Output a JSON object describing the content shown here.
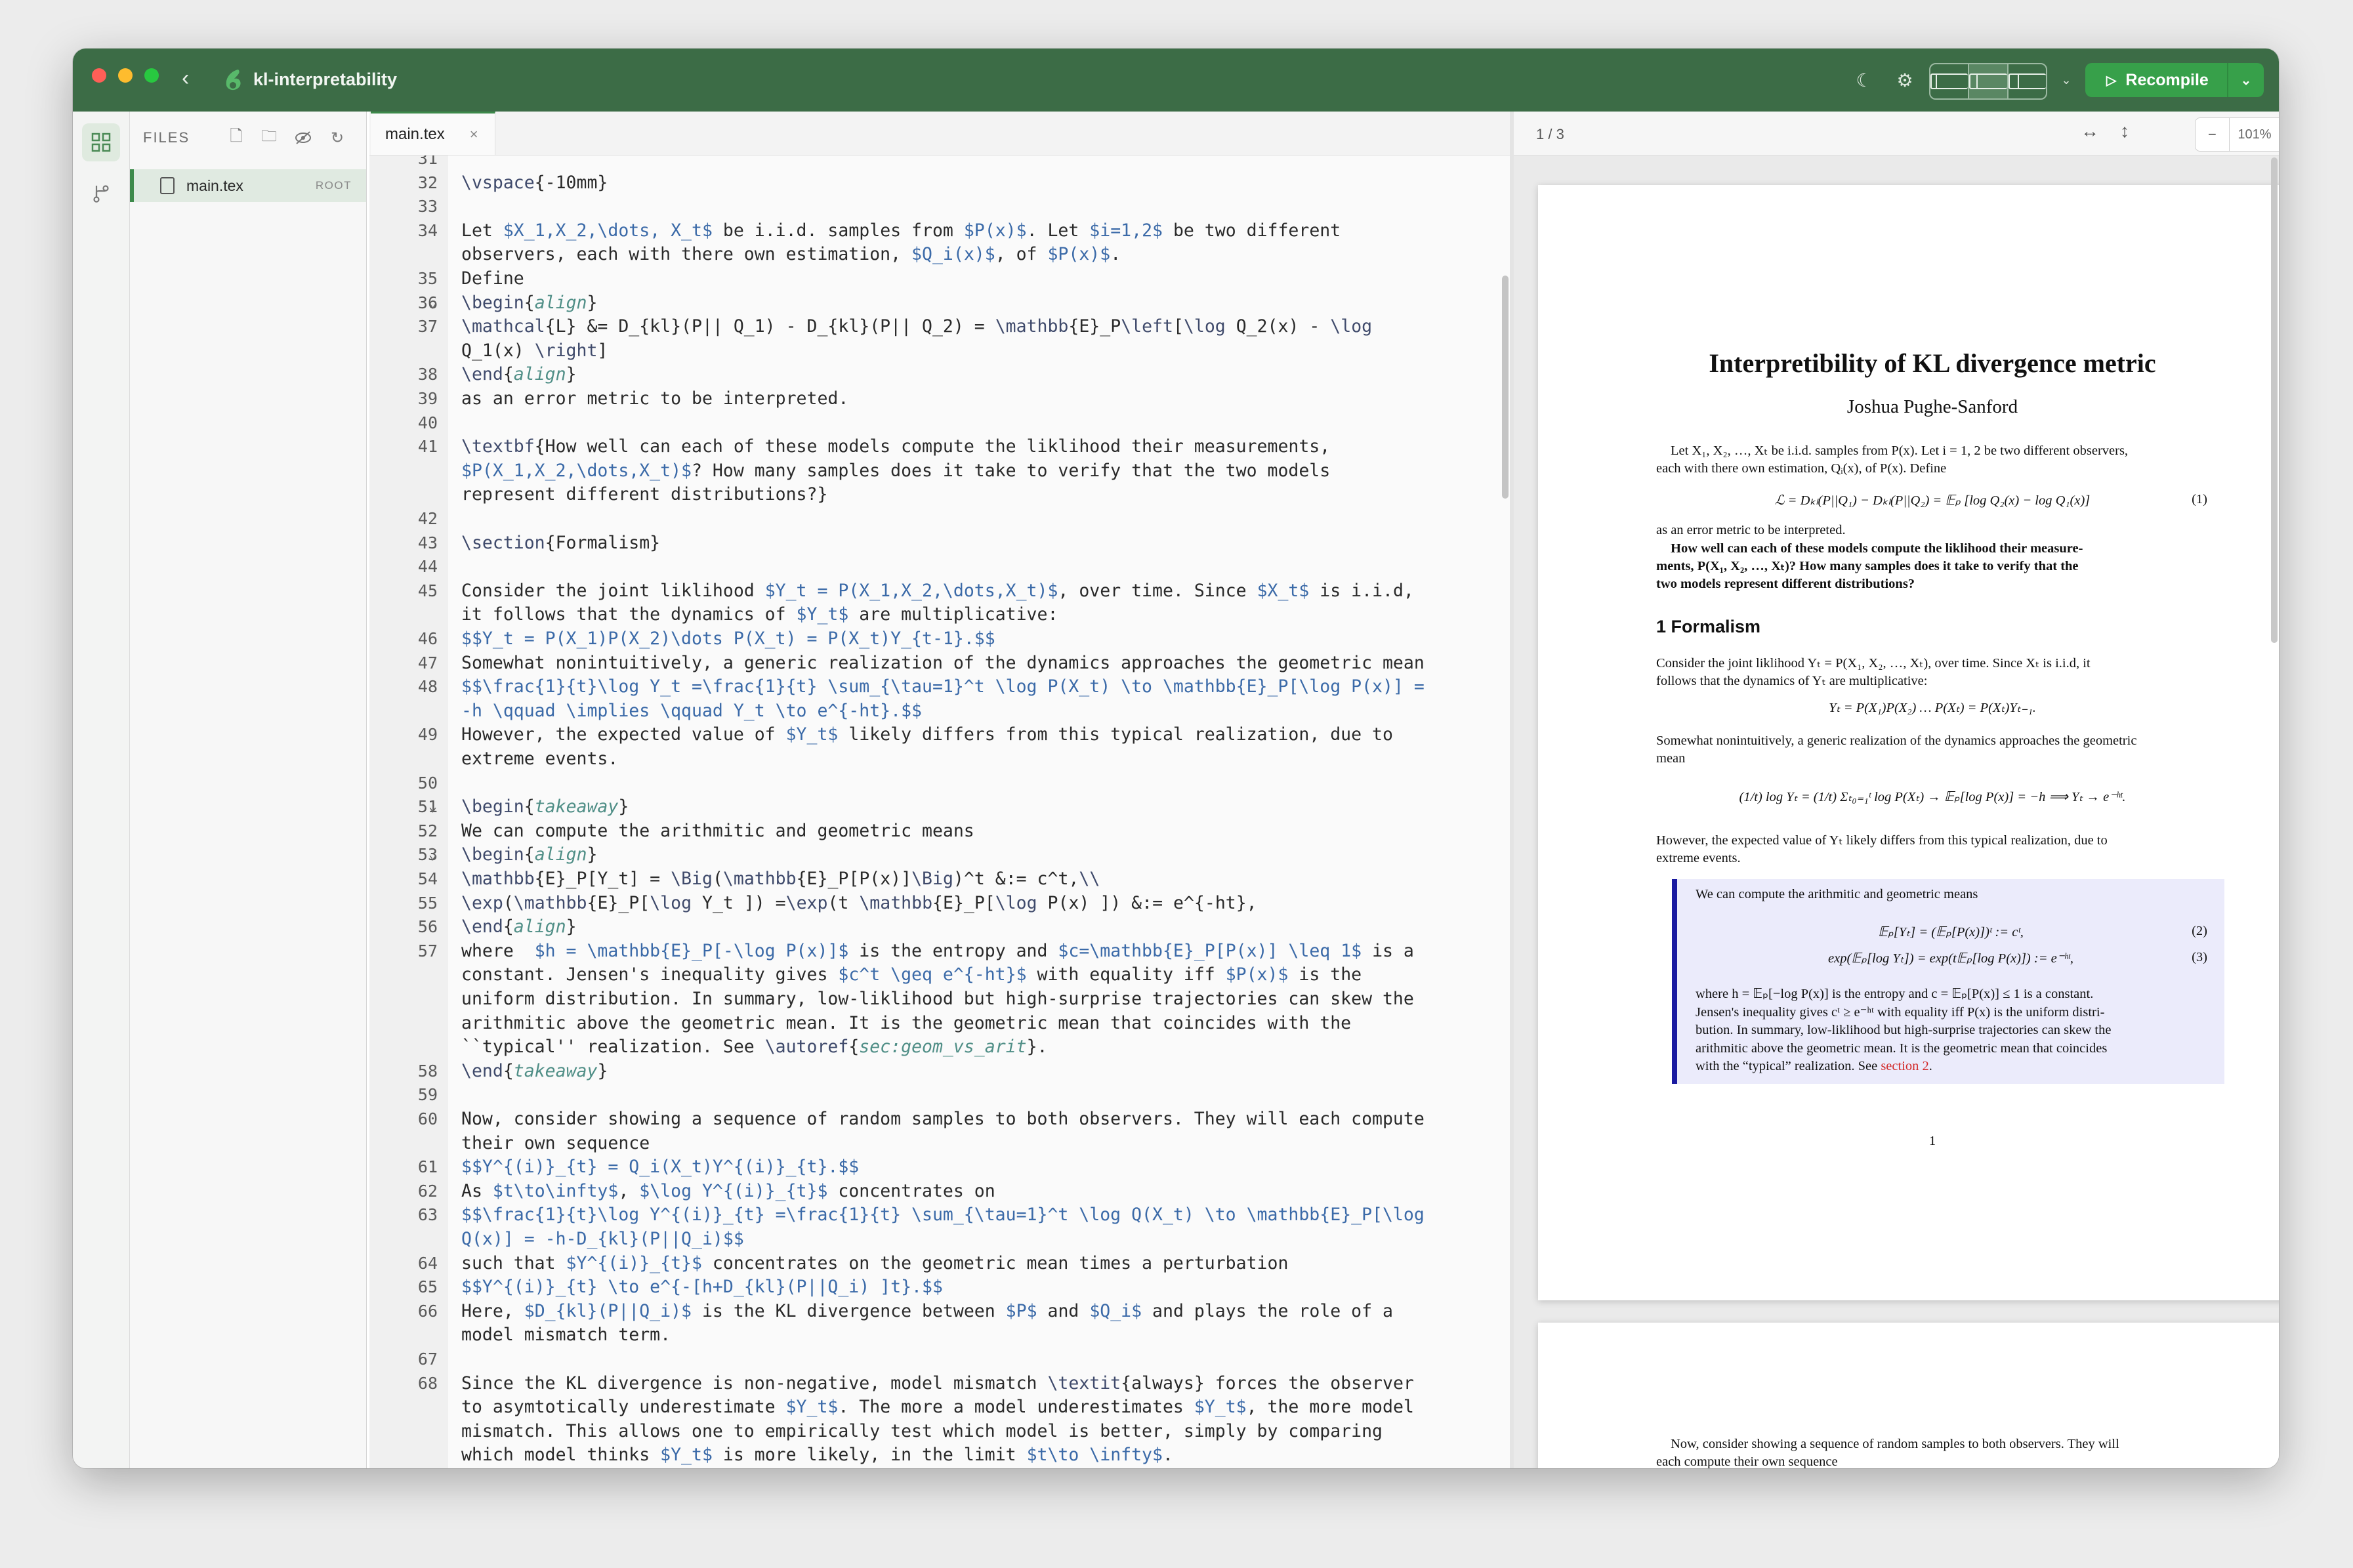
{
  "titlebar": {
    "project_name": "kl-interpretability",
    "recompile_label": "Recompile"
  },
  "file_panel": {
    "header": "FILES",
    "files": [
      {
        "name": "main.tex",
        "badge": "ROOT"
      }
    ]
  },
  "editor": {
    "tab_label": "main.tex",
    "lines": [
      {
        "n": "31",
        "segs": []
      },
      {
        "n": "32",
        "segs": [
          [
            "c",
            "\\vspace"
          ],
          [
            "t",
            "{-10mm}"
          ]
        ]
      },
      {
        "n": "33",
        "segs": []
      },
      {
        "n": "34",
        "segs": [
          [
            "t",
            "Let "
          ],
          [
            "m",
            "$X_1,X_2,\\dots, X_t$"
          ],
          [
            "t",
            " be i.i.d. samples from "
          ],
          [
            "m",
            "$P(x)$"
          ],
          [
            "t",
            ". Let "
          ],
          [
            "m",
            "$i=1,2$"
          ],
          [
            "t",
            " be two different"
          ]
        ]
      },
      {
        "n": "",
        "segs": [
          [
            "t",
            "observers, each with there own estimation, "
          ],
          [
            "m",
            "$Q_i(x)$"
          ],
          [
            "t",
            ", of "
          ],
          [
            "m",
            "$P(x)$"
          ],
          [
            "t",
            "."
          ]
        ]
      },
      {
        "n": "35",
        "segs": [
          [
            "t",
            "Define"
          ]
        ]
      },
      {
        "n": "36",
        "fold": true,
        "segs": [
          [
            "c",
            "\\begin"
          ],
          [
            "t",
            "{"
          ],
          [
            "e",
            "align"
          ],
          [
            "t",
            "}"
          ]
        ]
      },
      {
        "n": "37",
        "segs": [
          [
            "c",
            "\\mathcal"
          ],
          [
            "t",
            "{L} &= D_{kl}(P|| Q_1) - D_{kl}(P|| Q_2) = "
          ],
          [
            "c",
            "\\mathbb"
          ],
          [
            "t",
            "{E}_P"
          ],
          [
            "c",
            "\\left"
          ],
          [
            "t",
            "["
          ],
          [
            "c",
            "\\log"
          ],
          [
            "t",
            " Q_2(x) - "
          ],
          [
            "c",
            "\\log"
          ]
        ]
      },
      {
        "n": "",
        "segs": [
          [
            "t",
            "Q_1(x) "
          ],
          [
            "c",
            "\\right"
          ],
          [
            "t",
            "]"
          ]
        ]
      },
      {
        "n": "38",
        "segs": [
          [
            "c",
            "\\end"
          ],
          [
            "t",
            "{"
          ],
          [
            "e",
            "align"
          ],
          [
            "t",
            "}"
          ]
        ]
      },
      {
        "n": "39",
        "segs": [
          [
            "t",
            "as an error metric to be interpreted."
          ]
        ]
      },
      {
        "n": "40",
        "segs": []
      },
      {
        "n": "41",
        "segs": [
          [
            "c",
            "\\textbf"
          ],
          [
            "t",
            "{How well can each of these models compute the liklihood their measurements,"
          ]
        ]
      },
      {
        "n": "",
        "segs": [
          [
            "m",
            "$P(X_1,X_2,\\dots,X_t)$"
          ],
          [
            "t",
            "? How many samples does it take to verify that the two models"
          ]
        ]
      },
      {
        "n": "",
        "segs": [
          [
            "t",
            "represent different distributions?}"
          ]
        ]
      },
      {
        "n": "42",
        "segs": []
      },
      {
        "n": "43",
        "segs": [
          [
            "c",
            "\\section"
          ],
          [
            "t",
            "{Formalism}"
          ]
        ]
      },
      {
        "n": "44",
        "segs": []
      },
      {
        "n": "45",
        "segs": [
          [
            "t",
            "Consider the joint liklihood "
          ],
          [
            "m",
            "$Y_t = P(X_1,X_2,\\dots,X_t)$"
          ],
          [
            "t",
            ", over time. Since "
          ],
          [
            "m",
            "$X_t$"
          ],
          [
            "t",
            " is i.i.d,"
          ]
        ]
      },
      {
        "n": "",
        "segs": [
          [
            "t",
            "it follows that the dynamics of "
          ],
          [
            "m",
            "$Y_t$"
          ],
          [
            "t",
            " are multiplicative:"
          ]
        ]
      },
      {
        "n": "46",
        "segs": [
          [
            "m",
            "$$Y_t = P(X_1)P(X_2)\\dots P(X_t) = P(X_t)Y_{t-1}.$$"
          ]
        ]
      },
      {
        "n": "47",
        "segs": [
          [
            "t",
            "Somewhat nonintuitively, a generic realization of the dynamics approaches the geometric mean"
          ]
        ]
      },
      {
        "n": "48",
        "segs": [
          [
            "m",
            "$$\\frac{1}{t}\\log Y_t =\\frac{1}{t} \\sum_{\\tau=1}^t \\log P(X_t) \\to \\mathbb{E}_P[\\log P(x)] ="
          ]
        ]
      },
      {
        "n": "",
        "segs": [
          [
            "m",
            "-h \\qquad \\implies \\qquad Y_t \\to e^{-ht}.$$"
          ]
        ]
      },
      {
        "n": "49",
        "segs": [
          [
            "t",
            "However, the expected value of "
          ],
          [
            "m",
            "$Y_t$"
          ],
          [
            "t",
            " likely differs from this typical realization, due to"
          ]
        ]
      },
      {
        "n": "",
        "segs": [
          [
            "t",
            "extreme events."
          ]
        ]
      },
      {
        "n": "50",
        "segs": []
      },
      {
        "n": "51",
        "fold": true,
        "segs": [
          [
            "c",
            "\\begin"
          ],
          [
            "t",
            "{"
          ],
          [
            "e",
            "takeaway"
          ],
          [
            "t",
            "}"
          ]
        ]
      },
      {
        "n": "52",
        "segs": [
          [
            "t",
            "We can compute the arithmitic and geometric means"
          ]
        ]
      },
      {
        "n": "53",
        "fold": true,
        "segs": [
          [
            "c",
            "\\begin"
          ],
          [
            "t",
            "{"
          ],
          [
            "e",
            "align"
          ],
          [
            "t",
            "}"
          ]
        ]
      },
      {
        "n": "54",
        "segs": [
          [
            "c",
            "\\mathbb"
          ],
          [
            "t",
            "{E}_P[Y_t] = "
          ],
          [
            "c",
            "\\Big"
          ],
          [
            "t",
            "("
          ],
          [
            "c",
            "\\mathbb"
          ],
          [
            "t",
            "{E}_P[P(x)]"
          ],
          [
            "c",
            "\\Big"
          ],
          [
            "t",
            ")^t &:= c^t,"
          ],
          [
            "c",
            "\\\\"
          ]
        ]
      },
      {
        "n": "55",
        "segs": [
          [
            "c",
            "\\exp"
          ],
          [
            "t",
            "("
          ],
          [
            "c",
            "\\mathbb"
          ],
          [
            "t",
            "{E}_P["
          ],
          [
            "c",
            "\\log"
          ],
          [
            "t",
            " Y_t ]) ="
          ],
          [
            "c",
            "\\exp"
          ],
          [
            "t",
            "(t "
          ],
          [
            "c",
            "\\mathbb"
          ],
          [
            "t",
            "{E}_P["
          ],
          [
            "c",
            "\\log"
          ],
          [
            "t",
            " P(x) ]) &:= e^{-ht},"
          ]
        ]
      },
      {
        "n": "56",
        "segs": [
          [
            "c",
            "\\end"
          ],
          [
            "t",
            "{"
          ],
          [
            "e",
            "align"
          ],
          [
            "t",
            "}"
          ]
        ]
      },
      {
        "n": "57",
        "segs": [
          [
            "t",
            "where  "
          ],
          [
            "m",
            "$h = \\mathbb{E}_P[-\\log P(x)]$"
          ],
          [
            "t",
            " is the entropy and "
          ],
          [
            "m",
            "$c=\\mathbb{E}_P[P(x)] \\leq 1$"
          ],
          [
            "t",
            " is a"
          ]
        ]
      },
      {
        "n": "",
        "segs": [
          [
            "t",
            "constant. Jensen's inequality gives "
          ],
          [
            "m",
            "$c^t \\geq e^{-ht}$"
          ],
          [
            "t",
            " with equality iff "
          ],
          [
            "m",
            "$P(x)$"
          ],
          [
            "t",
            " is the"
          ]
        ]
      },
      {
        "n": "",
        "segs": [
          [
            "t",
            "uniform distribution. In summary, low-liklihood but high-surprise trajectories can skew the"
          ]
        ]
      },
      {
        "n": "",
        "segs": [
          [
            "t",
            "arithmitic above the geometric mean. It is the geometric mean that coincides with the"
          ]
        ]
      },
      {
        "n": "",
        "segs": [
          [
            "t",
            "``typical'' realization. See "
          ],
          [
            "c",
            "\\autoref"
          ],
          [
            "t",
            "{"
          ],
          [
            "e",
            "sec:geom_vs_arit"
          ],
          [
            "t",
            "}."
          ]
        ]
      },
      {
        "n": "58",
        "segs": [
          [
            "c",
            "\\end"
          ],
          [
            "t",
            "{"
          ],
          [
            "e",
            "takeaway"
          ],
          [
            "t",
            "}"
          ]
        ]
      },
      {
        "n": "59",
        "segs": []
      },
      {
        "n": "60",
        "segs": [
          [
            "t",
            "Now, consider showing a sequence of random samples to both observers. They will each compute"
          ]
        ]
      },
      {
        "n": "",
        "segs": [
          [
            "t",
            "their own sequence"
          ]
        ]
      },
      {
        "n": "61",
        "segs": [
          [
            "m",
            "$$Y^{(i)}_{t} = Q_i(X_t)Y^{(i)}_{t}.$$"
          ]
        ]
      },
      {
        "n": "62",
        "segs": [
          [
            "t",
            "As "
          ],
          [
            "m",
            "$t\\to\\infty$"
          ],
          [
            "t",
            ", "
          ],
          [
            "m",
            "$\\log Y^{(i)}_{t}$"
          ],
          [
            "t",
            " concentrates on"
          ]
        ]
      },
      {
        "n": "63",
        "segs": [
          [
            "m",
            "$$\\frac{1}{t}\\log Y^{(i)}_{t} =\\frac{1}{t} \\sum_{\\tau=1}^t \\log Q(X_t) \\to \\mathbb{E}_P[\\log"
          ]
        ]
      },
      {
        "n": "",
        "segs": [
          [
            "m",
            "Q(x)] = -h-D_{kl}(P||Q_i)$$"
          ]
        ]
      },
      {
        "n": "64",
        "segs": [
          [
            "t",
            "such that "
          ],
          [
            "m",
            "$Y^{(i)}_{t}$"
          ],
          [
            "t",
            " concentrates on the geometric mean times a perturbation"
          ]
        ]
      },
      {
        "n": "65",
        "segs": [
          [
            "m",
            "$$Y^{(i)}_{t} \\to e^{-[h+D_{kl}(P||Q_i) ]t}.$$"
          ]
        ]
      },
      {
        "n": "66",
        "segs": [
          [
            "t",
            "Here, "
          ],
          [
            "m",
            "$D_{kl}(P||Q_i)$"
          ],
          [
            "t",
            " is the KL divergence between "
          ],
          [
            "m",
            "$P$"
          ],
          [
            "t",
            " and "
          ],
          [
            "m",
            "$Q_i$"
          ],
          [
            "t",
            " and plays the role of a"
          ]
        ]
      },
      {
        "n": "",
        "segs": [
          [
            "t",
            "model mismatch term."
          ]
        ]
      },
      {
        "n": "67",
        "segs": []
      },
      {
        "n": "68",
        "segs": [
          [
            "t",
            "Since the KL divergence is non-negative, model mismatch "
          ],
          [
            "c",
            "\\textit"
          ],
          [
            "t",
            "{always} forces the observer"
          ]
        ]
      },
      {
        "n": "",
        "segs": [
          [
            "t",
            "to asymtotically underestimate "
          ],
          [
            "m",
            "$Y_t$"
          ],
          [
            "t",
            ". The more a model underestimates "
          ],
          [
            "m",
            "$Y_t$"
          ],
          [
            "t",
            ", the more model"
          ]
        ]
      },
      {
        "n": "",
        "segs": [
          [
            "t",
            "mismatch. This allows one to empirically test which model is better, simply by comparing"
          ]
        ]
      },
      {
        "n": "",
        "segs": [
          [
            "t",
            "which model thinks "
          ],
          [
            "m",
            "$Y_t$"
          ],
          [
            "t",
            " is more likely, in the limit "
          ],
          [
            "m",
            "$t\\to \\infty$"
          ],
          [
            "t",
            "."
          ]
        ]
      }
    ]
  },
  "pdf": {
    "page_indicator": "1 / 3",
    "zoom": "101%",
    "title": "Interpretibility of KL divergence metric",
    "author": "Joshua Pughe-Sanford",
    "intro_1": "Let X₁, X₂, …, Xₜ be i.i.d. samples from P(x). Let i = 1, 2 be two different observers,",
    "intro_2": "each with there own estimation, Qᵢ(x), of P(x). Define",
    "eq1": "ℒ = Dₖₗ(P||Q₁) − Dₖₗ(P||Q₂) = 𝔼ₚ [log Q₂(x) − log Q₁(x)]",
    "eq1_num": "(1)",
    "after_eq1": "as an error metric to be interpreted.",
    "bold_1": "How well can each of these models compute the liklihood their measure-",
    "bold_2": "ments, P(X₁, X₂, …, Xₜ)?  How many samples does it take to verify that the",
    "bold_3": "two models represent different distributions?",
    "section": "1  Formalism",
    "sec_p1": "Consider the joint liklihood Yₜ = P(X₁, X₂, …, Xₜ), over time.  Since Xₜ is i.i.d, it",
    "sec_p2": "follows that the dynamics of Yₜ are multiplicative:",
    "eq_mult": "Yₜ = P(X₁)P(X₂) … P(Xₜ) = P(Xₜ)Yₜ₋₁.",
    "somewhat_1": "Somewhat nonintuitively, a generic realization of the dynamics approaches the geometric",
    "somewhat_2": "mean",
    "eq_geo": "(1/t) log Yₜ = (1/t) Σₜ₀₌₁ᵗ log P(Xₜ) → 𝔼ₚ[log P(x)] = −h        ⟹        Yₜ → e⁻ʰᵗ.",
    "however_1": "However, the expected value of Yₜ likely differs from this typical realization, due to",
    "however_2": "extreme events.",
    "box_intro": "We can compute the arithmitic and geometric means",
    "eq2": "𝔼ₚ[Yₜ] = (𝔼ₚ[P(x)])ᵗ := cᵗ,",
    "eq2_num": "(2)",
    "eq3": "exp(𝔼ₚ[log Yₜ]) = exp(t𝔼ₚ[log P(x)]) := e⁻ʰᵗ,",
    "eq3_num": "(3)",
    "box_1": "where h = 𝔼ₚ[−log P(x)] is the entropy and c = 𝔼ₚ[P(x)] ≤ 1 is a constant.",
    "box_2": "Jensen's inequality gives cᵗ ≥ e⁻ʰᵗ with equality iff P(x) is the uniform distri-",
    "box_3": "bution.  In summary, low-liklihood but high-surprise trajectories can skew the",
    "box_4": "arithmitic above the geometric mean.  It is the geometric mean that coincides",
    "box_5a": "with the “typical” realization. See ",
    "box_5link": "section 2",
    "box_5b": ".",
    "page_num": "1",
    "p2_1": "Now, consider showing a sequence of random samples to both observers.  They will",
    "p2_2": "each compute their own sequence"
  },
  "colors": {
    "titlebar": "#3c6c46",
    "accent": "#37a04a",
    "math": "#3b6aa8",
    "env": "#4f8e86",
    "takeaway_box": "#ebebfb",
    "takeaway_bar": "#1a1aa0",
    "link": "#d22a2a"
  }
}
